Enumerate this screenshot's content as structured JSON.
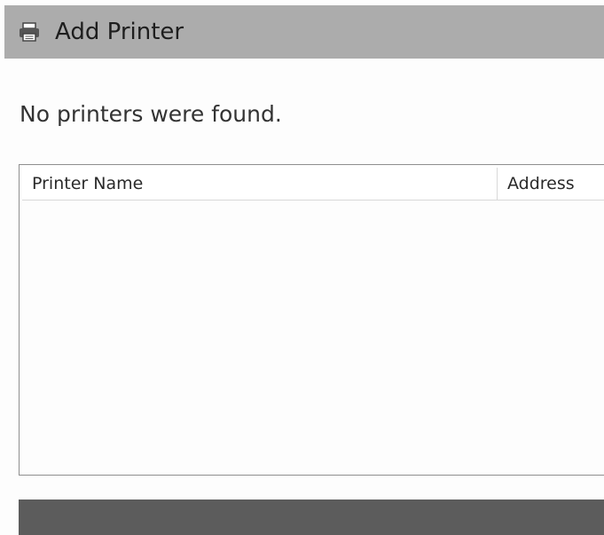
{
  "window": {
    "title": "Add Printer",
    "icon": "printer-icon"
  },
  "main": {
    "message": "No printers were found."
  },
  "printer_list": {
    "columns": [
      "Printer Name",
      "Address"
    ],
    "rows": []
  },
  "colors": {
    "titlebar_bg": "#acacac",
    "bottom_bar_bg": "#5c5c5c"
  }
}
